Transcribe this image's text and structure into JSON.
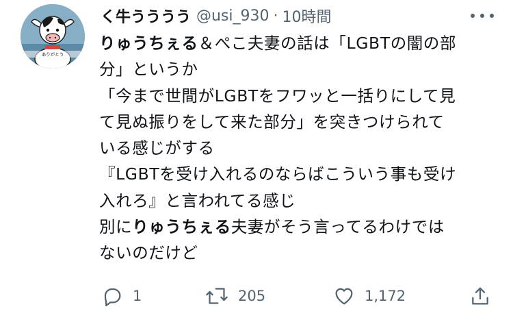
{
  "tweet": {
    "display_name": "く牛うううう",
    "handle": "@usi_930",
    "separator": "·",
    "timestamp": "10時間",
    "avatar_text": "ありがとう",
    "lines": [
      [
        {
          "t": "りゅうちぇる",
          "b": true
        },
        {
          "t": "＆ぺこ夫妻の話は「LGBTの闇の部",
          "b": false
        }
      ],
      [
        {
          "t": "分」というか",
          "b": false
        }
      ],
      [
        {
          "t": "「今まで世間がLGBTをフワッと一括りにして見",
          "b": false
        }
      ],
      [
        {
          "t": "て見ぬ振りをして来た部分」を突きつけられて",
          "b": false
        }
      ],
      [
        {
          "t": "いる感じがする",
          "b": false
        }
      ],
      [
        {
          "t": "『LGBTを受け入れるのならばこういう事も受け",
          "b": false
        }
      ],
      [
        {
          "t": "入れろ』と言われてる感じ",
          "b": false
        }
      ],
      [
        {
          "t": "別に",
          "b": false
        },
        {
          "t": "りゅうちぇる",
          "b": true
        },
        {
          "t": "夫妻がそう言ってるわけでは",
          "b": false
        }
      ],
      [
        {
          "t": "ないのだけど",
          "b": false
        }
      ]
    ]
  },
  "actions": {
    "reply": {
      "icon": "reply-icon",
      "count": "1"
    },
    "retweet": {
      "icon": "retweet-icon",
      "count": "205"
    },
    "like": {
      "icon": "heart-icon",
      "count": "1,172"
    },
    "share": {
      "icon": "share-icon"
    }
  },
  "colors": {
    "text": "#0f1419",
    "secondary": "#536471",
    "background": "#ffffff"
  }
}
